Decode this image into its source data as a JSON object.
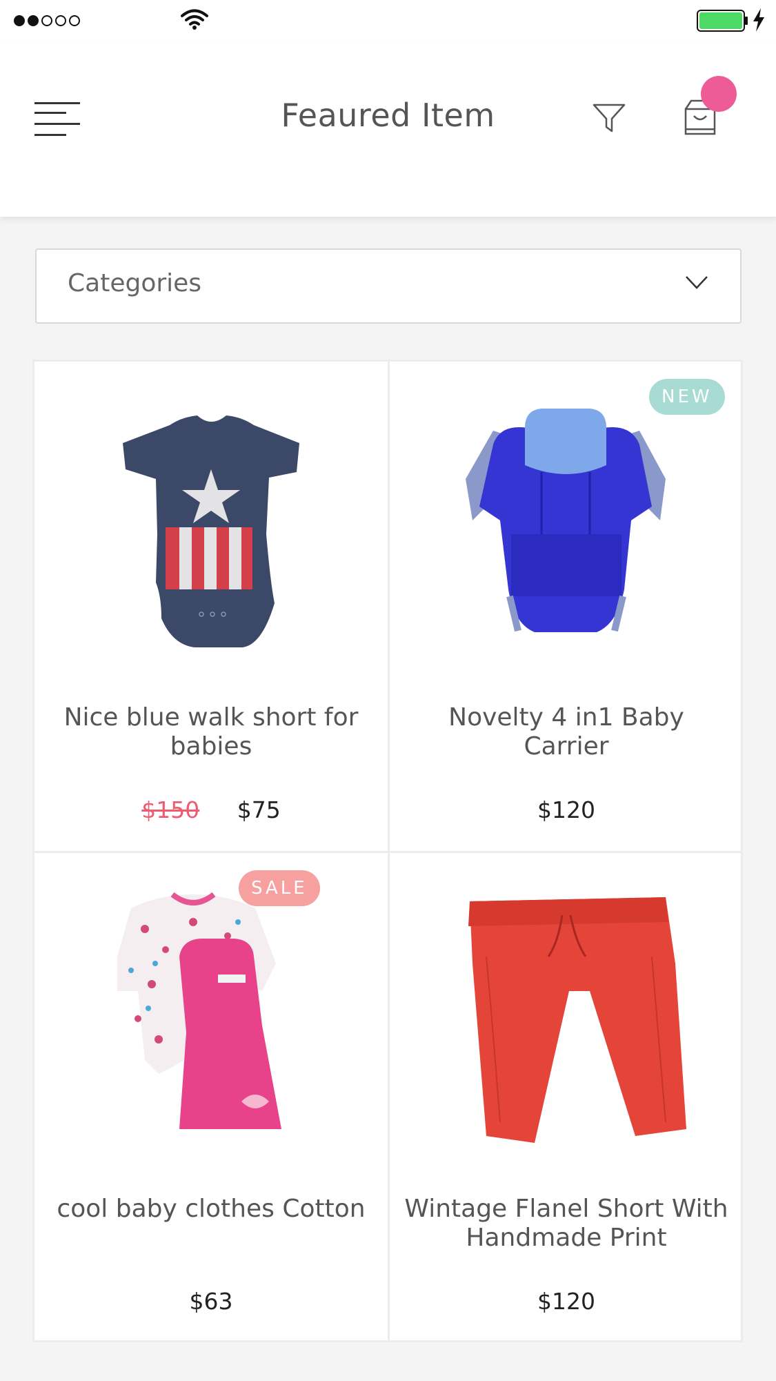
{
  "status_bar": {
    "signal": "signal-dots",
    "wifi": "wifi-icon",
    "battery": "battery-icon",
    "charging": "charging-bolt-icon",
    "battery_color": "#4cd964"
  },
  "header": {
    "title": "Feaured Item",
    "menu_icon": "hamburger-menu-icon",
    "filter_icon": "filter-icon",
    "cart_icon": "shopping-bag-icon",
    "badge_color": "#ee5c97"
  },
  "categories": {
    "label": "Categories",
    "icon": "chevron-down-icon"
  },
  "products": [
    {
      "name": "Nice blue walk short for babies",
      "old_price": "$150",
      "price": "$75",
      "badge": "",
      "image": "baby-bodysuit-image"
    },
    {
      "name": "Novelty 4 in1 Baby Carrier",
      "old_price": "",
      "price": "$120",
      "badge": "NEW",
      "image": "baby-carrier-image"
    },
    {
      "name": "cool baby clothes Cotton",
      "old_price": "",
      "price": "$63",
      "badge": "SALE",
      "image": "baby-dress-set-image"
    },
    {
      "name": "Wintage Flanel Short With Handmade Print",
      "old_price": "",
      "price": "$120",
      "badge": "",
      "image": "red-pants-image"
    }
  ],
  "colors": {
    "accent_pink": "#ee5c97",
    "old_price": "#ee5c72",
    "badge_new": "#a7dbd3",
    "badge_sale": "#f6a0a0"
  }
}
